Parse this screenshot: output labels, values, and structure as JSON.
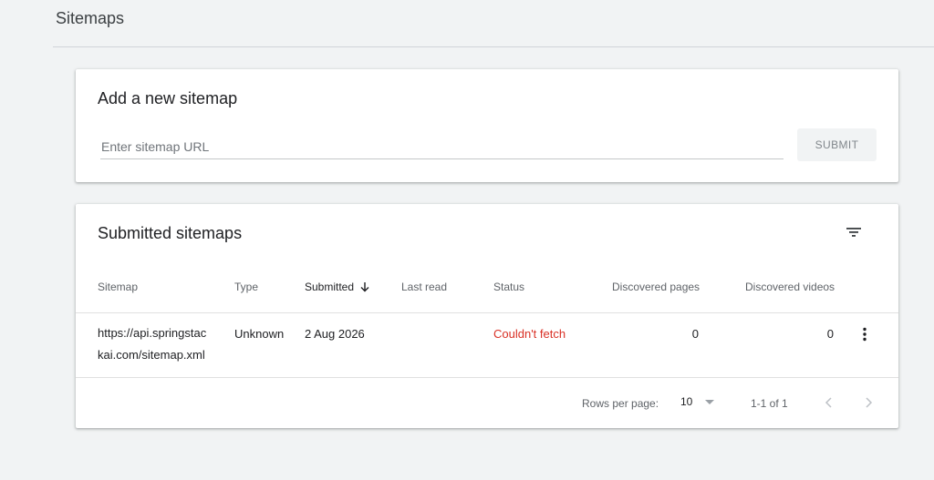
{
  "header": {
    "title": "Sitemaps"
  },
  "add_card": {
    "title": "Add a new sitemap",
    "input_placeholder": "Enter sitemap URL",
    "input_value": "",
    "submit_label": "SUBMIT"
  },
  "list_card": {
    "title": "Submitted sitemaps",
    "filter_icon": "filter-list-icon",
    "columns": {
      "sitemap": "Sitemap",
      "type": "Type",
      "submitted": "Submitted",
      "last_read": "Last read",
      "status": "Status",
      "discovered_pages": "Discovered pages",
      "discovered_videos": "Discovered videos"
    },
    "sort_icon": "arrow-downward-icon",
    "rows": [
      {
        "sitemap_line1": "https://api.springstac",
        "sitemap_line2": "kai.com/sitemap.xml",
        "type": "Unknown",
        "submitted": "2 Aug 2026",
        "last_read": "",
        "status": "Couldn't fetch",
        "discovered_pages": "0",
        "discovered_videos": "0"
      }
    ],
    "footer": {
      "rows_per_page_label": "Rows per page:",
      "rows_per_page_value": "10",
      "range_label": "1-1 of 1"
    }
  },
  "colors": {
    "background": "#f1f3f4",
    "error": "#d93025",
    "card": "#ffffff"
  }
}
